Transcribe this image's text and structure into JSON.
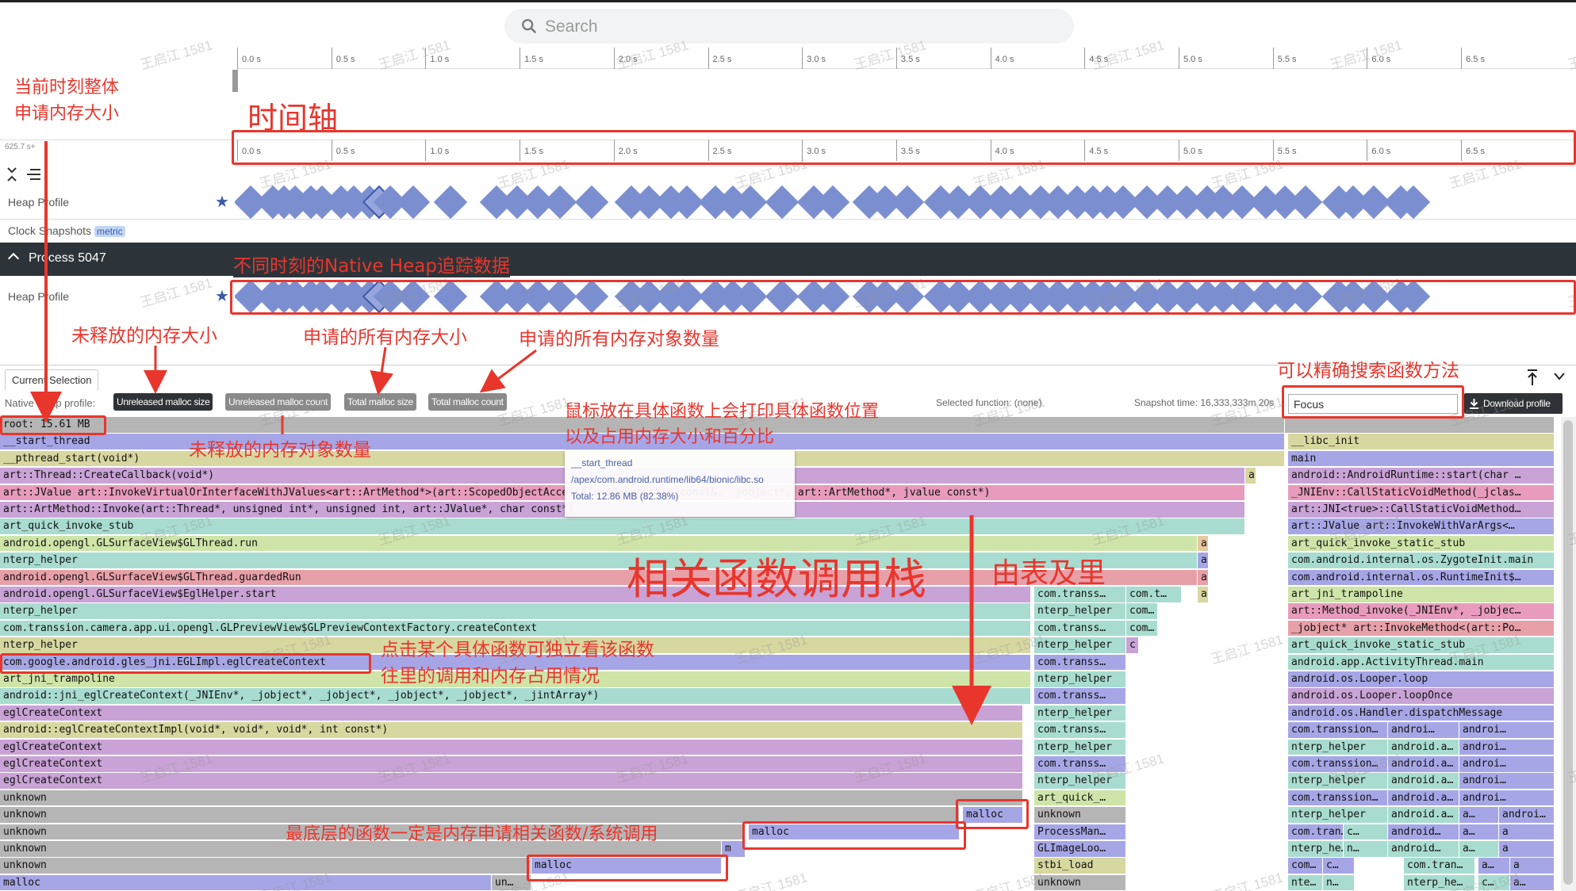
{
  "search": {
    "placeholder": "Search"
  },
  "timeline": {
    "ticks": [
      "0.0 s",
      "0.5 s",
      "1.0 s",
      "1.5 s",
      "2.0 s",
      "2.5 s",
      "3.0 s",
      "3.5 s",
      "4.0 s",
      "4.5 s",
      "5.0 s",
      "5.5 s",
      "6.0 s",
      "6.5 s"
    ],
    "cursor_label": "625.7 s+"
  },
  "tracks": {
    "heap_profile": "Heap Profile",
    "clock_snapshots": "Clock Snapshots",
    "metric_badge": "metric",
    "process": "Process 5047",
    "process_heap": "Heap Profile"
  },
  "tabs": {
    "current_selection": "Current Selection"
  },
  "toolbar": {
    "native_heap_label": "Native Heap profile:",
    "chips": [
      "Unreleased malloc size",
      "Unreleased malloc count",
      "Total malloc size",
      "Total malloc count"
    ],
    "selected_function": "Selected function: (none)",
    "snapshot_time": "Snapshot time: 16,333,333m 20s",
    "focus_value": "Focus",
    "download": "Download profile"
  },
  "tooltip": {
    "name": "__start_thread",
    "path": "/apex/com.android.runtime/lib64/bionic/libc.so",
    "total": "Total: 12.86 MB (82.38%)"
  },
  "colors": {
    "blue": "#7b8fd0",
    "annotation_red": "#e8362d",
    "dark_bar": "#2d3439"
  },
  "annotations": {
    "current_total": [
      "当前时刻整体",
      "申请内存大小"
    ],
    "timeline": "时间轴",
    "native_heap": "不同时刻的Native Heap追踪数据",
    "unreleased_size": "未释放的内存大小",
    "total_size": "申请的所有内存大小",
    "total_count": "申请的所有内存对象数量",
    "search_exact": "可以精确搜索函数方法",
    "unreleased_count": "未释放的内存对象数量",
    "hover": [
      "鼠标放在具体函数上会打印具体函数位置",
      "以及占用内存大小和百分比"
    ],
    "callstack": "相关函数调用栈",
    "outside_in": "由表及里",
    "click_fn": [
      "点击某个具体函数可独立看该函数",
      "往里的调用和内存占用情况"
    ],
    "bottom": "最底层的函数一定是内存申请相关函数/系统调用"
  },
  "watermark": "王启江 1581",
  "flame": {
    "rows": [
      [
        [
          0,
          1620,
          "root: 15.61 MB",
          "#b5b5b5"
        ],
        [
          1620,
          340,
          "",
          "#b5b5b5"
        ]
      ],
      [
        [
          0,
          1620,
          "__start_thread",
          "#a6a6e6"
        ],
        [
          1624,
          336,
          "__libc_init",
          "#d7d7a0"
        ]
      ],
      [
        [
          0,
          1620,
          "__pthread_start(void*)",
          "#d7d7a0"
        ],
        [
          1624,
          336,
          "main",
          "#a6a6e6"
        ]
      ],
      [
        [
          0,
          1570,
          "art::Thread::CreateCallback(void*)",
          "#c9a2d6"
        ],
        [
          1570,
          14,
          "a",
          "#d7d7a0"
        ],
        [
          1624,
          336,
          "android::AndroidRuntime::start(char …",
          "#c9a2d6"
        ]
      ],
      [
        [
          0,
          1570,
          "art::JValue art::InvokeVirtualOrInterfaceWithJValues<art::ArtMethod*>(art::ScopedObjectAccessAlreadyRunnable const&, _jobject*, art::ArtMethod*, jvalue const*)",
          "#e89bbc"
        ],
        [
          1624,
          336,
          "_JNIEnv::CallStaticVoidMethod(_jclas…",
          "#e89bbc"
        ]
      ],
      [
        [
          0,
          1570,
          "art::ArtMethod::Invoke(art::Thread*, unsigned int*, unsigned int, art::JValue*, char const*)",
          "#c9a2d6"
        ],
        [
          1624,
          336,
          "art::JNI<true>::CallStaticVoidMethod…",
          "#c9a2d6"
        ]
      ],
      [
        [
          0,
          1570,
          "art_quick_invoke_stub",
          "#a8dcd0"
        ],
        [
          1624,
          336,
          "art::JValue art::InvokeWithVarArgs<…",
          "#a6a6e6"
        ]
      ],
      [
        [
          0,
          1510,
          "android.opengl.GLSurfaceView$GLThread.run",
          "#cfe4a8"
        ],
        [
          1510,
          14,
          "a",
          "#e8c8a0"
        ],
        [
          1624,
          336,
          "art_quick_invoke_static_stub",
          "#cfe4a8"
        ]
      ],
      [
        [
          0,
          1510,
          "nterp_helper",
          "#a8dcd0"
        ],
        [
          1510,
          14,
          "a",
          "#a6a6e6"
        ],
        [
          1624,
          336,
          "com.android.internal.os.ZygoteInit.main",
          "#a8dcd0"
        ]
      ],
      [
        [
          0,
          1510,
          "android.opengl.GLSurfaceView$GLThread.guardedRun",
          "#e8a0a8"
        ],
        [
          1510,
          14,
          "a",
          "#e8a0a8"
        ],
        [
          1624,
          336,
          "com.android.internal.os.RuntimeInit$…",
          "#a6a6e6"
        ]
      ],
      [
        [
          0,
          1300,
          "android.opengl.GLSurfaceView$EglHelper.start",
          "#c9a2d6"
        ],
        [
          1304,
          116,
          "com.transs…",
          "#a8dcd0"
        ],
        [
          1420,
          70,
          "com.t…",
          "#a8dcd0"
        ],
        [
          1510,
          14,
          "a",
          "#d7d7a0"
        ],
        [
          1624,
          336,
          "art_jni_trampoline",
          "#cfe4a8"
        ]
      ],
      [
        [
          0,
          1300,
          "nterp_helper",
          "#a8dcd0"
        ],
        [
          1304,
          116,
          "nterp_helper",
          "#a8dcd0"
        ],
        [
          1420,
          40,
          "com…",
          "#a8dcd0"
        ],
        [
          1624,
          336,
          "art::Method_invoke(_JNIEnv*, _jobjec…",
          "#e89bbc"
        ]
      ],
      [
        [
          0,
          1300,
          "com.transsion.camera.app.ui.opengl.GLPreviewView$GLPreviewContextFactory.createContext",
          "#a8dcd0"
        ],
        [
          1304,
          116,
          "com.transs…",
          "#a8dcd0"
        ],
        [
          1420,
          40,
          "com…",
          "#a8dcd0"
        ],
        [
          1624,
          336,
          "_jobject* art::InvokeMethod<(art::Po…",
          "#e8a0a8"
        ]
      ],
      [
        [
          0,
          1300,
          "nterp_helper",
          "#d7d7a0"
        ],
        [
          1304,
          116,
          "nterp_helper",
          "#a8dcd0"
        ],
        [
          1420,
          16,
          "c",
          "#c9a2d6"
        ],
        [
          1624,
          336,
          "art_quick_invoke_static_stub",
          "#a8dcd0"
        ]
      ],
      [
        [
          0,
          1300,
          "com.google.android.gles_jni.EGLImpl.eglCreateContext",
          "#a6a6e6"
        ],
        [
          1304,
          116,
          "com.transs…",
          "#a6a6e6"
        ],
        [
          1624,
          336,
          "android.app.ActivityThread.main",
          "#a8dcd0"
        ]
      ],
      [
        [
          0,
          1300,
          "art_jni_trampoline",
          "#cfe4a8"
        ],
        [
          1304,
          116,
          "nterp_helper",
          "#a8dcd0"
        ],
        [
          1624,
          336,
          "android.os.Looper.loop",
          "#a6a6e6"
        ]
      ],
      [
        [
          0,
          1300,
          "android::jni_eglCreateContext(_JNIEnv*, _jobject*, _jobject*, _jobject*, _jobject*, _jintArray*)",
          "#a8dcd0"
        ],
        [
          1304,
          116,
          "com.transs…",
          "#a6a6e6"
        ],
        [
          1624,
          336,
          "android.os.Looper.loopOnce",
          "#c9a2d6"
        ]
      ],
      [
        [
          0,
          1290,
          "eglCreateContext",
          "#c9a2d6"
        ],
        [
          1304,
          116,
          "nterp_helper",
          "#a8dcd0"
        ],
        [
          1624,
          336,
          "android.os.Handler.dispatchMessage",
          "#a6a6e6"
        ]
      ],
      [
        [
          0,
          1290,
          "android::eglCreateContextImpl(void*, void*, void*, int const*)",
          "#d7d7a0"
        ],
        [
          1304,
          116,
          "com.transs…",
          "#a8dcd0"
        ],
        [
          1624,
          126,
          "com.transsion…",
          "#a6a6e6"
        ],
        [
          1750,
          90,
          "androi…",
          "#a6a6e6"
        ],
        [
          1840,
          120,
          "androi…",
          "#a6a6e6"
        ]
      ],
      [
        [
          0,
          1290,
          "eglCreateContext",
          "#c9a2d6"
        ],
        [
          1304,
          116,
          "nterp_helper",
          "#a8dcd0"
        ],
        [
          1624,
          126,
          "nterp_helper",
          "#a8dcd0"
        ],
        [
          1750,
          90,
          "android.a…",
          "#a8dcd0"
        ],
        [
          1840,
          120,
          "androi…",
          "#a6a6e6"
        ]
      ],
      [
        [
          0,
          1290,
          "eglCreateContext",
          "#c9a2d6"
        ],
        [
          1304,
          116,
          "com.transs…",
          "#a6a6e6"
        ],
        [
          1624,
          126,
          "com.transsion…",
          "#a6a6e6"
        ],
        [
          1750,
          90,
          "android.a…",
          "#a6a6e6"
        ],
        [
          1840,
          120,
          "androi…",
          "#a6a6e6"
        ]
      ],
      [
        [
          0,
          1290,
          "eglCreateContext",
          "#c9a2d6"
        ],
        [
          1304,
          116,
          "nterp_helper",
          "#a8dcd0"
        ],
        [
          1624,
          126,
          "nterp_helper",
          "#a8dcd0"
        ],
        [
          1750,
          90,
          "android.a…",
          "#a8dcd0"
        ],
        [
          1840,
          120,
          "androi…",
          "#a6a6e6"
        ]
      ],
      [
        [
          0,
          1290,
          "unknown",
          "#b5b5b5"
        ],
        [
          1304,
          116,
          "art_quick_…",
          "#cfe4a8"
        ],
        [
          1624,
          126,
          "com.transsion…",
          "#a6a6e6"
        ],
        [
          1750,
          90,
          "android.a…",
          "#a6a6e6"
        ],
        [
          1840,
          120,
          "androi…",
          "#a6a6e6"
        ]
      ],
      [
        [
          0,
          1210,
          "unknown",
          "#b5b5b5"
        ],
        [
          1214,
          76,
          "malloc",
          "#a6a6e6"
        ],
        [
          1304,
          116,
          "unknown",
          "#b5b5b5"
        ],
        [
          1624,
          126,
          "nterp_helper",
          "#a8dcd0"
        ],
        [
          1750,
          90,
          "android.a…",
          "#a8dcd0"
        ],
        [
          1840,
          50,
          "a…",
          "#a6a6e6"
        ],
        [
          1890,
          70,
          "androi…",
          "#a6a6e6"
        ]
      ],
      [
        [
          0,
          940,
          "unknown",
          "#b5b5b5"
        ],
        [
          944,
          266,
          "malloc",
          "#a6a6e6"
        ],
        [
          1304,
          116,
          "ProcessMan…",
          "#a6a6e6"
        ],
        [
          1624,
          70,
          "com.tran…",
          "#a6a6e6"
        ],
        [
          1694,
          56,
          "c…",
          "#a8dcd0"
        ],
        [
          1750,
          90,
          "android…",
          "#a6a6e6"
        ],
        [
          1840,
          50,
          "a…",
          "#a6a6e6"
        ],
        [
          1890,
          70,
          "a",
          "#a6a6e6"
        ]
      ],
      [
        [
          0,
          910,
          "unknown",
          "#b5b5b5"
        ],
        [
          910,
          30,
          "m",
          "#a6a6e6"
        ],
        [
          1304,
          116,
          "GLImageLoo…",
          "#a6a6e6"
        ],
        [
          1624,
          70,
          "nterp_he…",
          "#a8dcd0"
        ],
        [
          1694,
          56,
          "n…",
          "#a8dcd0"
        ],
        [
          1750,
          90,
          "android…",
          "#a8dcd0"
        ],
        [
          1840,
          50,
          "a…",
          "#a8dcd0"
        ],
        [
          1890,
          70,
          "a",
          "#a6a6e6"
        ]
      ],
      [
        [
          0,
          670,
          "unknown",
          "#b5b5b5"
        ],
        [
          670,
          240,
          "malloc",
          "#a6a6e6"
        ],
        [
          1304,
          116,
          "stbi_load",
          "#d7d7a0"
        ],
        [
          1624,
          44,
          "com…",
          "#a6a6e6"
        ],
        [
          1668,
          40,
          "c…",
          "#a6a6e6"
        ],
        [
          1770,
          90,
          "com.tran…",
          "#a8dcd0"
        ],
        [
          1864,
          40,
          "a…",
          "#a6a6e6"
        ],
        [
          1904,
          56,
          "a",
          "#a6a6e6"
        ]
      ],
      [
        [
          0,
          620,
          "malloc",
          "#a6a6e6"
        ],
        [
          620,
          50,
          "un…",
          "#b5b5b5"
        ],
        [
          1304,
          116,
          "unknown",
          "#b5b5b5"
        ],
        [
          1624,
          44,
          "nte…",
          "#a8dcd0"
        ],
        [
          1668,
          40,
          "n…",
          "#a8dcd0"
        ],
        [
          1770,
          90,
          "nterp_he…",
          "#a8dcd0"
        ],
        [
          1864,
          40,
          "c…",
          "#a8dcd0"
        ],
        [
          1904,
          56,
          "a…",
          "#a6a6e6"
        ]
      ]
    ]
  }
}
